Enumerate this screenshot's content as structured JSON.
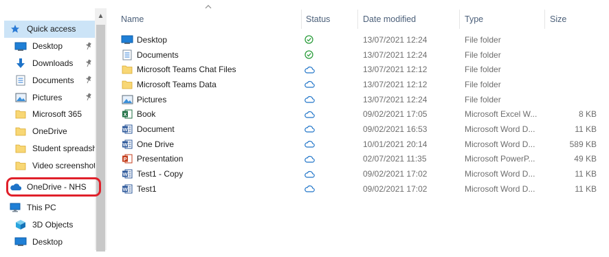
{
  "nav": {
    "quick_access": "Quick access",
    "items": [
      {
        "label": "Desktop",
        "icon": "desktop-icon",
        "pinned": true
      },
      {
        "label": "Downloads",
        "icon": "download-arrow-icon",
        "pinned": true
      },
      {
        "label": "Documents",
        "icon": "documents-icon",
        "pinned": true
      },
      {
        "label": "Pictures",
        "icon": "pictures-icon",
        "pinned": true
      },
      {
        "label": "Microsoft 365",
        "icon": "folder-icon"
      },
      {
        "label": "OneDrive",
        "icon": "folder-icon"
      },
      {
        "label": "Student spreadsheets",
        "icon": "folder-icon"
      },
      {
        "label": "Video screenshots",
        "icon": "folder-icon"
      }
    ],
    "onedrive": "OneDrive - NHS",
    "this_pc": "This PC",
    "pc_items": [
      {
        "label": "3D Objects",
        "icon": "3d-objects-icon"
      },
      {
        "label": "Desktop",
        "icon": "desktop-icon"
      }
    ]
  },
  "columns": {
    "name": "Name",
    "status": "Status",
    "date": "Date modified",
    "type": "Type",
    "size": "Size"
  },
  "files": [
    {
      "name": "Desktop",
      "icon": "desktop-folder-icon",
      "status": "synced",
      "date": "13/07/2021 12:24",
      "type": "File folder",
      "size": ""
    },
    {
      "name": "Documents",
      "icon": "documents-folder-icon",
      "status": "synced",
      "date": "13/07/2021 12:24",
      "type": "File folder",
      "size": ""
    },
    {
      "name": "Microsoft Teams Chat Files",
      "icon": "folder-icon",
      "status": "cloud",
      "date": "13/07/2021 12:12",
      "type": "File folder",
      "size": ""
    },
    {
      "name": "Microsoft Teams Data",
      "icon": "folder-icon",
      "status": "cloud",
      "date": "13/07/2021 12:12",
      "type": "File folder",
      "size": ""
    },
    {
      "name": "Pictures",
      "icon": "pictures-folder-icon",
      "status": "cloud",
      "date": "13/07/2021 12:24",
      "type": "File folder",
      "size": ""
    },
    {
      "name": "Book",
      "icon": "excel-icon",
      "status": "cloud",
      "date": "09/02/2021 17:05",
      "type": "Microsoft Excel W...",
      "size": "8 KB"
    },
    {
      "name": "Document",
      "icon": "word-icon",
      "status": "cloud",
      "date": "09/02/2021 16:53",
      "type": "Microsoft Word D...",
      "size": "11 KB"
    },
    {
      "name": "One Drive",
      "icon": "word-icon",
      "status": "cloud",
      "date": "10/01/2021 20:14",
      "type": "Microsoft Word D...",
      "size": "589 KB"
    },
    {
      "name": "Presentation",
      "icon": "powerpoint-icon",
      "status": "cloud",
      "date": "02/07/2021 11:35",
      "type": "Microsoft PowerP...",
      "size": "49 KB"
    },
    {
      "name": "Test1 - Copy",
      "icon": "word-icon",
      "status": "cloud",
      "date": "09/02/2021 17:02",
      "type": "Microsoft Word D...",
      "size": "11 KB"
    },
    {
      "name": "Test1",
      "icon": "word-icon",
      "status": "cloud",
      "date": "09/02/2021 17:02",
      "type": "Microsoft Word D...",
      "size": "11 KB"
    }
  ],
  "colors": {
    "selection": "#cce4f7",
    "highlight_ring": "#e0202a",
    "folder": "#f8d775",
    "synced": "#2e9e3e",
    "cloud": "#1e73c8",
    "excel": "#1d6f42",
    "word": "#2b579a",
    "powerpoint": "#c43e1c"
  }
}
